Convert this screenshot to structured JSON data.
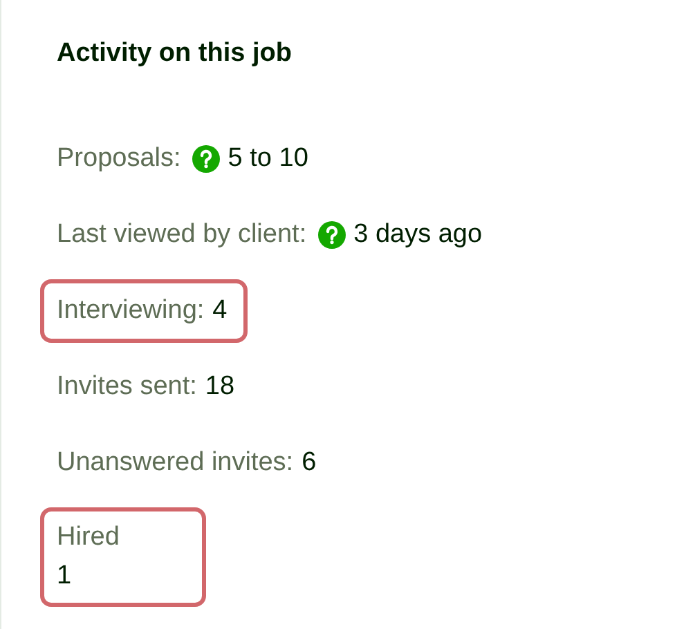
{
  "title": "Activity on this job",
  "stats": [
    {
      "kind": "inline",
      "label": "Proposals:",
      "help": true,
      "value": "5 to 10",
      "highlighted": false
    },
    {
      "kind": "inline",
      "label": "Last viewed by client:",
      "help": true,
      "value": "3 days ago",
      "highlighted": false
    },
    {
      "kind": "inline",
      "label": "Interviewing:",
      "help": false,
      "value": "4",
      "highlighted": true
    },
    {
      "kind": "inline",
      "label": "Invites sent:",
      "help": false,
      "value": "18",
      "highlighted": false
    },
    {
      "kind": "inline",
      "label": "Unanswered invites:",
      "help": false,
      "value": "6",
      "highlighted": false
    },
    {
      "kind": "stacked",
      "label": "Hired",
      "help": false,
      "value": "1",
      "highlighted": true
    }
  ]
}
